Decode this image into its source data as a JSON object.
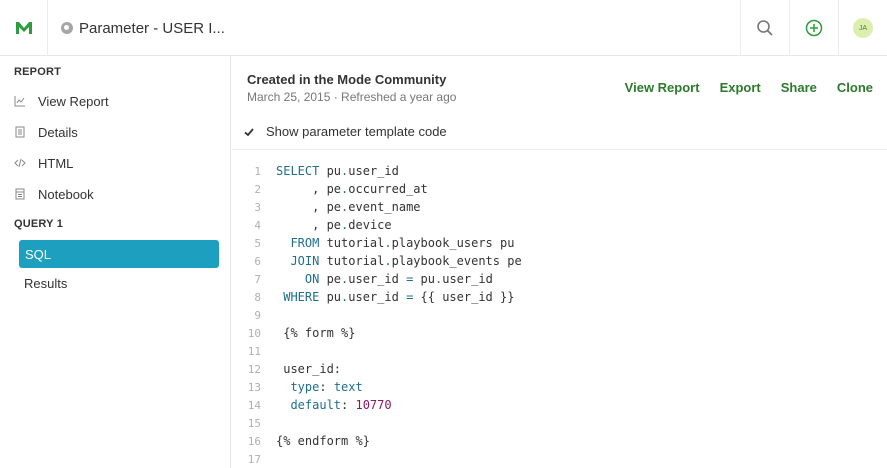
{
  "topbar": {
    "title": "Parameter - USER I...",
    "avatar_initials": "JA",
    "brand_color": "#2c9d3c"
  },
  "sidebar": {
    "report_header": "REPORT",
    "report_items": [
      {
        "label": "View Report",
        "icon": "chart-icon"
      },
      {
        "label": "Details",
        "icon": "document-icon"
      },
      {
        "label": "HTML",
        "icon": "code-icon"
      },
      {
        "label": "Notebook",
        "icon": "notebook-icon"
      }
    ],
    "query_header": "QUERY 1",
    "sql_label": "SQL",
    "results_label": "Results",
    "active_color": "#1d9fbf"
  },
  "header": {
    "created": "Created in the Mode Community",
    "meta": "March 25, 2015 · Refreshed a year ago",
    "actions": [
      "View Report",
      "Export",
      "Share",
      "Clone"
    ]
  },
  "toggle": {
    "label": "Show parameter template code",
    "checked": true
  },
  "code": {
    "lines": [
      {
        "n": "1",
        "text": "SELECT pu.user_id"
      },
      {
        "n": "2",
        "text": "     , pe.occurred_at"
      },
      {
        "n": "3",
        "text": "     , pe.event_name"
      },
      {
        "n": "4",
        "text": "     , pe.device"
      },
      {
        "n": "5",
        "text": "  FROM tutorial.playbook_users pu"
      },
      {
        "n": "6",
        "text": "  JOIN tutorial.playbook_events pe"
      },
      {
        "n": "7",
        "text": "    ON pe.user_id = pu.user_id"
      },
      {
        "n": "8",
        "text": " WHERE pu.user_id = {{ user_id }}"
      },
      {
        "n": "9",
        "text": ""
      },
      {
        "n": "10",
        "text": " {% form %}"
      },
      {
        "n": "11",
        "text": ""
      },
      {
        "n": "12",
        "text": " user_id:"
      },
      {
        "n": "13",
        "text": "  type: text"
      },
      {
        "n": "14",
        "text": "  default: 10770"
      },
      {
        "n": "15",
        "text": ""
      },
      {
        "n": "16",
        "text": "{% endform %}"
      },
      {
        "n": "17",
        "text": ""
      }
    ]
  }
}
